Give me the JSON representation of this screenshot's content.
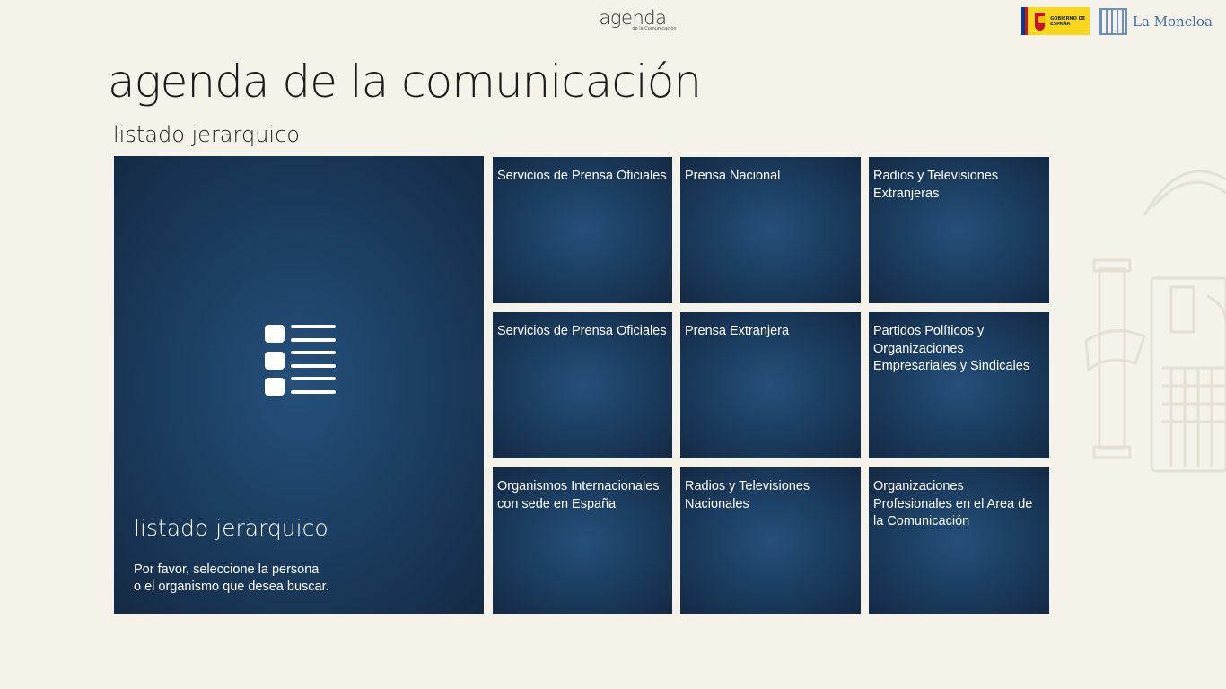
{
  "header": {
    "logo_main": "agenda",
    "logo_sub": "de la Comunicación",
    "gobierno_text": "GOBIERNO DE ESPAÑA",
    "moncloa_text": "La Moncloa"
  },
  "page": {
    "title": "agenda de la comunicación",
    "subtitle": "listado jerarquico"
  },
  "feature_tile": {
    "label": "listado jerarquico",
    "desc_line1": "Por favor, seleccione la persona",
    "desc_line2": "o el organismo que desea buscar.",
    "icon": "list-icon"
  },
  "tiles": [
    {
      "label": "Servicios de Prensa Oficiales"
    },
    {
      "label": "Prensa Nacional"
    },
    {
      "label": "Radios y Televisiones Extranjeras"
    },
    {
      "label": "Servicios de Prensa Oficiales"
    },
    {
      "label": "Prensa Extranjera"
    },
    {
      "label": "Partidos Políticos y Organizaciones Empresariales y Sindicales"
    },
    {
      "label": "Organismos Internacionales con sede en España"
    },
    {
      "label": "Radios y Televisiones Nacionales"
    },
    {
      "label": "Organizaciones Profesionales en el Area de la Comunicación"
    }
  ],
  "colors": {
    "background": "#f5f2ea",
    "tile": "#1c3f63"
  }
}
